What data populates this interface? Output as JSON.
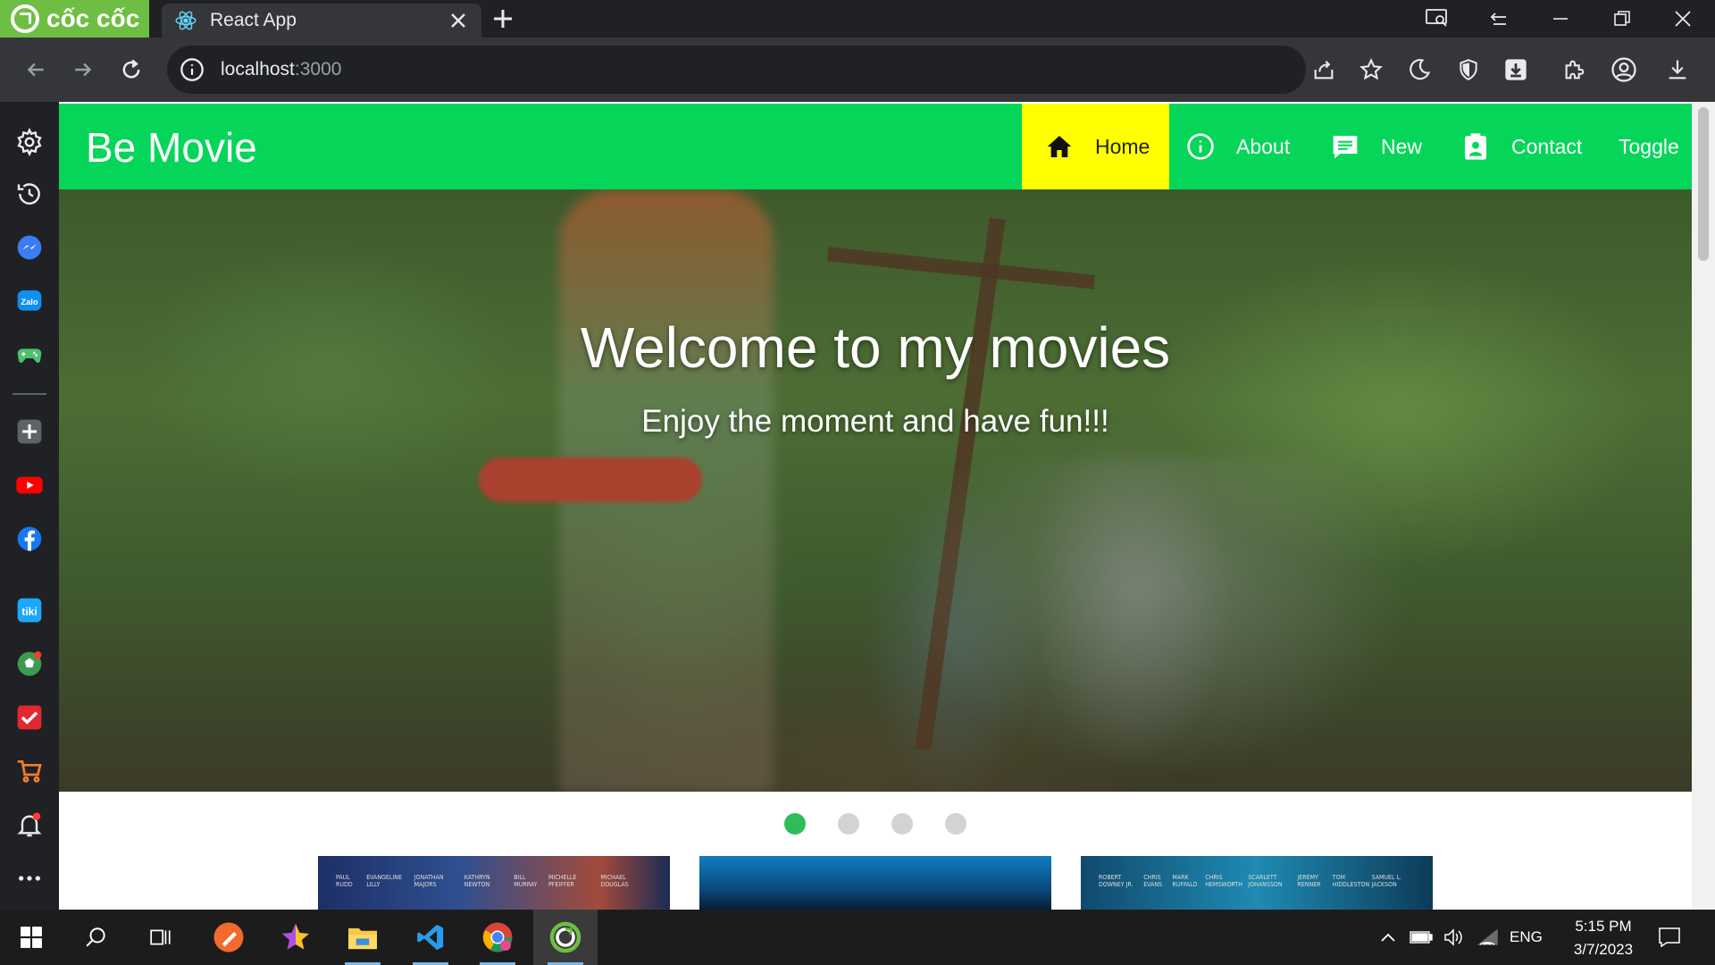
{
  "browser": {
    "brand": "cốc cốc",
    "tab": {
      "title": "React App"
    },
    "address": {
      "host": "localhost",
      "port": ":3000"
    }
  },
  "navbar": {
    "title": "Be Movie",
    "items": [
      {
        "label": "Home",
        "icon": "home-icon"
      },
      {
        "label": "About",
        "icon": "info-icon"
      },
      {
        "label": "New",
        "icon": "news-icon"
      },
      {
        "label": "Contact",
        "icon": "contact-icon"
      },
      {
        "label": "Toggle"
      }
    ],
    "colors": {
      "background": "#05d65a",
      "active": "#ffff00"
    }
  },
  "hero": {
    "headline": "Welcome to my movies",
    "subline": "Enjoy the moment and have fun!!!"
  },
  "carousel": {
    "slides": 4,
    "active_index": 0,
    "active_color": "#2ebd59"
  },
  "posters": [
    {
      "names": [
        "PAUL RUDD",
        "EVANGELINE LILLY",
        "JONATHAN MAJORS",
        "KATHRYN NEWTON",
        "BILL MURRAY",
        "MICHELLE PFEIFFER",
        "MICHAEL DOUGLAS"
      ]
    },
    {
      "names": []
    },
    {
      "names": [
        "ROBERT DOWNEY JR.",
        "CHRIS EVANS",
        "MARK RUFFALO",
        "CHRIS HEMSWORTH",
        "SCARLETT JOHANSSON",
        "JEREMY RENNER",
        "TOM HIDDLESTON",
        "SAMUEL L. JACKSON"
      ]
    }
  ],
  "taskbar": {
    "language": "ENG",
    "time": "5:15 PM",
    "date": "3/7/2023"
  }
}
